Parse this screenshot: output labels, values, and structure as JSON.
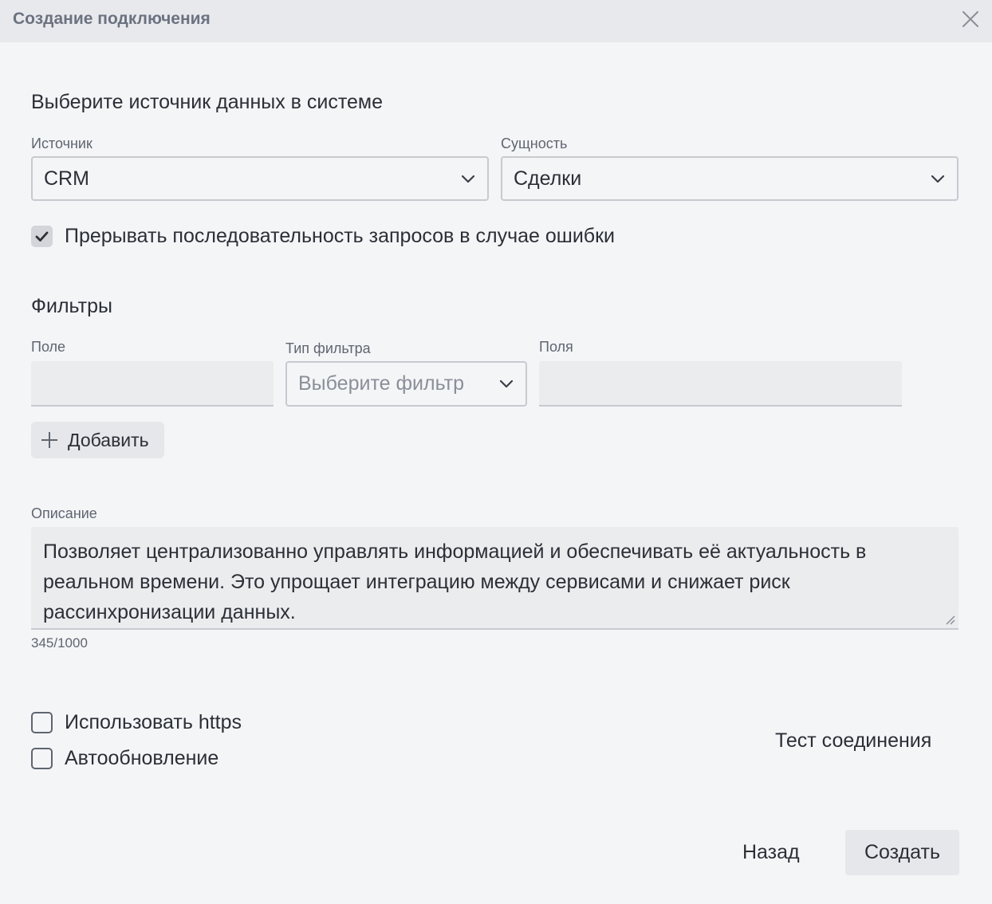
{
  "dialog": {
    "title": "Создание подключения",
    "close_icon": "close-icon"
  },
  "source_section": {
    "title": "Выберите источник данных в системе",
    "source_label": "Источник",
    "source_value": "CRM",
    "entity_label": "Сущность",
    "entity_value": "Сделки",
    "interrupt_checkbox": {
      "label": "Прерывать последовательность запросов в случае ошибки",
      "checked": true
    }
  },
  "filters": {
    "title": "Фильтры",
    "field_label": "Поле",
    "field_value": "",
    "type_label": "Тип фильтра",
    "type_placeholder": "Выберите фильтр",
    "fields_label": "Поля",
    "fields_value": "",
    "add_button_label": "Добавить"
  },
  "description": {
    "label": "Описание",
    "text": "Позволяет централизованно управлять информацией и обеспечивать её актуальность в реальном времени. Это упрощает интеграцию между сервисами и снижает риск рассинхронизации данных.",
    "counter": "345/1000"
  },
  "options": {
    "https_label": "Использовать https",
    "https_checked": false,
    "autoupdate_label": "Автообновление",
    "autoupdate_checked": false,
    "test_connection_label": "Тест соединения"
  },
  "footer": {
    "back_label": "Назад",
    "create_label": "Создать"
  },
  "colors": {
    "background": "#f4f5f7",
    "header": "#e8e9ec",
    "button": "#e6e7ea",
    "text": "#2b2f36",
    "muted": "#5f6570"
  }
}
